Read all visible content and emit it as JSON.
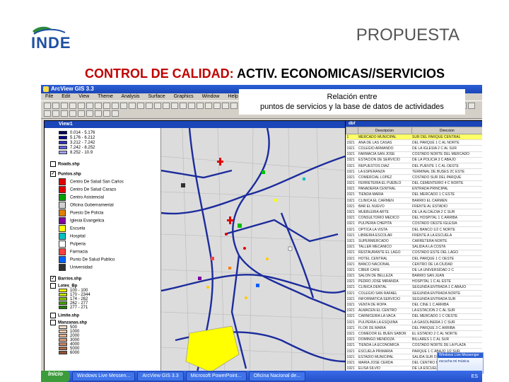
{
  "logo": {
    "text": "INDE"
  },
  "slide": {
    "title": "PROPUESTA",
    "subtitle_red": "CONTROL DE CALIDAD:",
    "subtitle_black": " ACTIV. ECONOMICAS//SERVICIOS"
  },
  "app": {
    "title": "ArcView GIS 3.3",
    "menu": [
      "File",
      "Edit",
      "View",
      "Theme",
      "Analysis",
      "Surface",
      "Graphics",
      "Window",
      "Help"
    ],
    "callout_line1": "Relación entre",
    "callout_line2": "puntos de servicios y la base de datos de actividades",
    "view_title": "View1",
    "table_title": "dbf"
  },
  "legend": {
    "range_rows": [
      "0.014 - 5.176",
      "5.176 - 6.212",
      "3.212 - 7.242",
      "7.242 - 8.252",
      "8.252 - 10.9"
    ],
    "range_colors": [
      "#000060",
      "#000090",
      "#3030c0",
      "#6060e0",
      "#a0a0ff"
    ],
    "theme_calles": "Roads.shp",
    "theme_puntos": "Puntos.shp",
    "point_rows": [
      {
        "label": "Centro De Salud San Carlos",
        "color": "#e00000"
      },
      {
        "label": "Centro De Salud Carazo",
        "color": "#e00000"
      },
      {
        "label": "Centro Asistencial",
        "color": "#00a000"
      },
      {
        "label": "Oficina Gubernamental",
        "color": "#d0d0d0"
      },
      {
        "label": "Puesto De Policia",
        "color": "#e08000"
      },
      {
        "label": "Iglesia Evangelica",
        "color": "#8000a0"
      },
      {
        "label": "Escuela",
        "color": "#ffff00"
      },
      {
        "label": "Hospital",
        "color": "#00c0c0"
      },
      {
        "label": "Pulperia",
        "color": "#ffffff"
      },
      {
        "label": "Farmacia",
        "color": "#ff4040"
      },
      {
        "label": "Punto De Salud Publico",
        "color": "#0060ff"
      },
      {
        "label": "Universidad",
        "color": "#303030"
      }
    ],
    "theme_barrios": "Barrios.shp",
    "theme_lots": "Lotes_Bp",
    "lot_rows": [
      "100 - 100",
      "170 - 2344",
      "174 - 262",
      "262 - 277",
      "277 - 271"
    ],
    "lot_colors": [
      "#ffff00",
      "#c0e000",
      "#80c000",
      "#40a000",
      "#208000"
    ],
    "theme_limite": "Limite.shp",
    "theme_manzanas": "Manzanas.shp",
    "block_rows": [
      "500",
      "1000",
      "2000",
      "3000",
      "4000",
      "5000",
      "6000"
    ],
    "block_colors": [
      "#f8e0c8",
      "#f0c8a8",
      "#e8b090",
      "#d89878",
      "#c88060",
      "#b06848",
      "#905030"
    ]
  },
  "table": {
    "headers": [
      "",
      "Descripcion",
      "Direccion"
    ],
    "rows": [
      [
        "1",
        "MERCADO MUNICIPAL",
        "SUR DEL PARQUE CENTRAL"
      ],
      [
        "1921",
        "ANA DE LAS CASAS",
        "DEL PARQUE 1 C AL NORTE"
      ],
      [
        "1921",
        "COLEGIO ARMANDO",
        "DE LA IGLESIA 2 C AL SUR"
      ],
      [
        "1921",
        "FARMACIA SAN JOSE",
        "COSTADO NORTE DEL MERCADO"
      ],
      [
        "1921",
        "ESTACION DE SERVICIO",
        "DE LA POLICIA 3 C ABAJO"
      ],
      [
        "1921",
        "REPUESTOS DIAZ",
        "DEL PUENTE 1 C AL OESTE"
      ],
      [
        "1921",
        "LA ESPERANZA",
        "TERMINAL DE BUSES 2C ESTE"
      ],
      [
        "1921",
        "COMERCIAL LOPEZ",
        "COSTADO SUR DEL PARQUE"
      ],
      [
        "1921",
        "FERRETERIA EL PUEBLO",
        "DEL CEMENTERIO 4 C NORTE"
      ],
      [
        "1921",
        "PANADERIA CENTRAL",
        "ENTRADA PRINCIPAL"
      ],
      [
        "1921",
        "TIENDA MARIA",
        "DEL MERCADO 1 C ESTE"
      ],
      [
        "1921",
        "CLINICA EL CARMEN",
        "BARRIO EL CARMEN"
      ],
      [
        "1921",
        "BAR EL NUEVO",
        "FRENTE AL ESTADIO"
      ],
      [
        "1921",
        "MUEBLERIA ARTE",
        "DE LA ALCALDIA 2 C SUR"
      ],
      [
        "1921",
        "CONSULTORIO MEDICO",
        "DEL HOSPITAL 1 C ARRIBA"
      ],
      [
        "1921",
        "PULPERIA CHEPITA",
        "COSTADO OESTE IGLESIA"
      ],
      [
        "1921",
        "OPTICA LA VISTA",
        "DEL BANCO 1/2 C NORTE"
      ],
      [
        "1921",
        "LIBRERIA ESCOLAR",
        "FRENTE A LA ESCUELA"
      ],
      [
        "1921",
        "SUPERMERCADO",
        "CARRETERA NORTE"
      ],
      [
        "1921",
        "TALLER MECANICO",
        "SALIDA A LA COSTA"
      ],
      [
        "1921",
        "RESTAURANTE EL LAGO",
        "COSTADO ESTE DEL LAGO"
      ],
      [
        "1921",
        "HOTEL CENTRAL",
        "DEL PARQUE 1 C OESTE"
      ],
      [
        "1921",
        "BANCO NACIONAL",
        "CENTRO DE LA CIUDAD"
      ],
      [
        "1921",
        "CIBER CAFE",
        "DE LA UNIVERSIDAD 2 C"
      ],
      [
        "1921",
        "SALON DE BELLEZA",
        "BARRIO SAN JUAN"
      ],
      [
        "1921",
        "PEDRO JOSE MIRANDA",
        "HOSPITAL 1 C AL ESTE"
      ],
      [
        "1921",
        "CLINICA DENTAL",
        "SEGUNDA ENTRADA 1 C ABAJO"
      ],
      [
        "1921",
        "COLEGIO SAN RAFAEL",
        "SEGUNDA ENTRADA NORTE"
      ],
      [
        "1921",
        "INFORMATICA SERVICIO",
        "SEGUNDA ENTRADA SUR"
      ],
      [
        "1921",
        "VENTA DE ROPA",
        "DEL CINE 1 C ARRIBA"
      ],
      [
        "1921",
        "ALMACEN EL CENTRO",
        "LA ESTACION 2 C AL SUR"
      ],
      [
        "1921",
        "CARNICERIA LA VACA",
        "DEL MERCADO 1 C OESTE"
      ],
      [
        "1921",
        "PULPERIA LA ESQUINA",
        "LA GASOLINERA 1 C SUR"
      ],
      [
        "1921",
        "FLOR DE MARIA",
        "DEL PARQUE 3 C ARRIBA"
      ],
      [
        "1921",
        "COMEDOR EL BUEN SABOR",
        "EL ESTADIO 2 C AL NORTE"
      ],
      [
        "1921",
        "DOMINGO MENDOZA",
        "BILLARES 1 C AL SUR"
      ],
      [
        "1921",
        "TIENDA LA ECONOMICA",
        "COSTADO NORTE DE LA PLAZA"
      ],
      [
        "1921",
        "ESCUELA PRIMARIA",
        "PARQUE 1 C ABAJO 1/2 SUR"
      ],
      [
        "1921",
        "ESTADIO MUNICIPAL",
        "SALIDA SUR DE LA CIUDAD"
      ],
      [
        "1921",
        "MARIA JOSE CERDA",
        "DEL CENTRO DE SALUD 1 C"
      ],
      [
        "1921",
        "ELISA SILVIO",
        "DE LA ESCUELA 1 C NORTE"
      ],
      [
        "1921",
        "GEORGINA MENDEZ",
        "DEL PUENTE 2 C ARRIBA"
      ],
      [
        "1921",
        "JOSE FELICIO GOMEZ",
        "BARRIO NUEVO"
      ]
    ]
  },
  "taskbar": {
    "start": "Inicio",
    "tasks": [
      "Windows Live Messen...",
      "ArcView GIS 3.3",
      "Microsoft PowerPoint...",
      "Oficina Nacional de..."
    ],
    "tray": "ES"
  },
  "messenger": {
    "title": "Windows Live Messenger",
    "body": "escucha mi música"
  }
}
